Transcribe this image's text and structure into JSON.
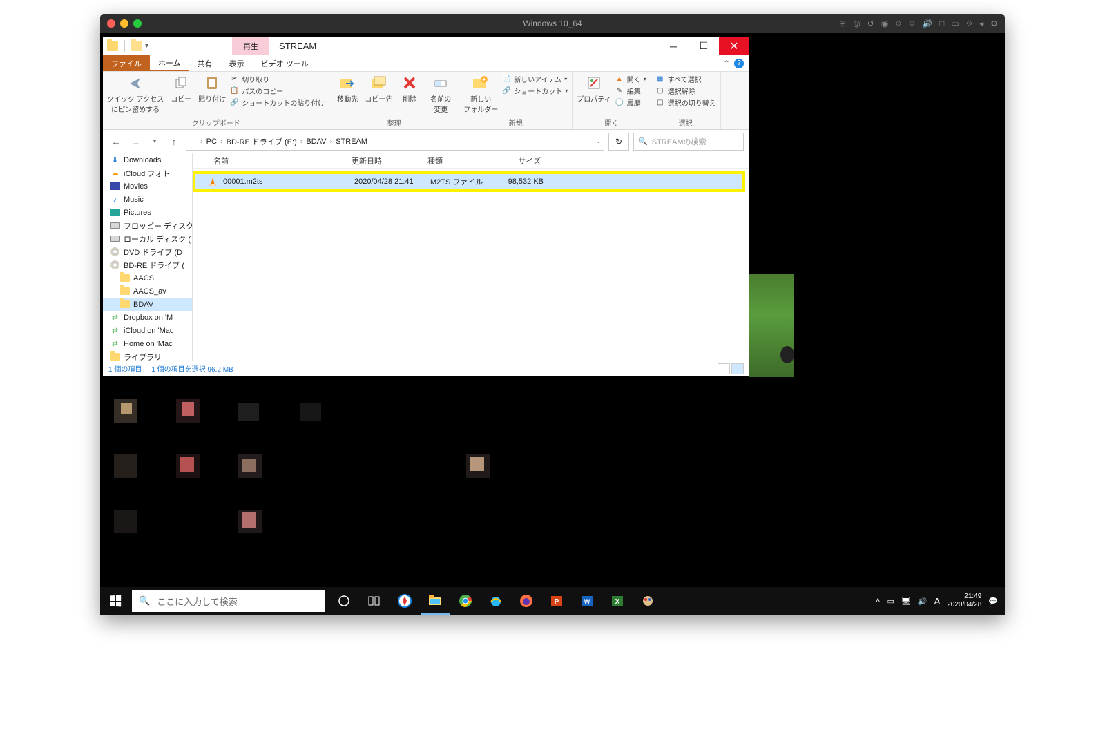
{
  "mac": {
    "title": "Windows 10_64",
    "menu_icons": [
      "⊞",
      "◎",
      "⟳",
      "⊙",
      "⟐",
      "⟐",
      "⟟",
      "⟐",
      "□",
      "⟐",
      "⟐",
      "❮",
      "⚙"
    ]
  },
  "explorer": {
    "playback_label": "再生",
    "window_title": "STREAM",
    "tabs": {
      "file": "ファイル",
      "home": "ホーム",
      "share": "共有",
      "view": "表示",
      "video": "ビデオ ツール"
    },
    "ribbon": {
      "clipboard": {
        "label": "クリップボード",
        "pin": "クイック アクセス\nにピン留めする",
        "copy": "コピー",
        "paste": "貼り付け",
        "cut": "切り取り",
        "copy_path": "パスのコピー",
        "paste_shortcut": "ショートカットの貼り付け"
      },
      "organize": {
        "label": "整理",
        "move": "移動先",
        "copyto": "コピー先",
        "delete": "削除",
        "rename": "名前の\n変更"
      },
      "new": {
        "label": "新規",
        "folder": "新しい\nフォルダー",
        "item": "新しいアイテム",
        "shortcut": "ショートカット"
      },
      "open": {
        "label": "開く",
        "props": "プロパティ",
        "open": "開く",
        "edit": "編集",
        "history": "履歴"
      },
      "select": {
        "label": "選択",
        "all": "すべて選択",
        "none": "選択解除",
        "invert": "選択の切り替え"
      }
    },
    "breadcrumb": [
      "PC",
      "BD-RE ドライブ (E:)",
      "BDAV",
      "STREAM"
    ],
    "search_placeholder": "STREAMの検索",
    "columns": {
      "name": "名前",
      "date": "更新日時",
      "type": "種類",
      "size": "サイズ"
    },
    "nav_items": [
      {
        "label": "Downloads",
        "icon": "down"
      },
      {
        "label": "iCloud フォト",
        "icon": "icloud"
      },
      {
        "label": "Movies",
        "icon": "movie"
      },
      {
        "label": "Music",
        "icon": "music"
      },
      {
        "label": "Pictures",
        "icon": "pic"
      },
      {
        "label": "フロッピー ディスク",
        "icon": "drive"
      },
      {
        "label": "ローカル ディスク (",
        "icon": "drive"
      },
      {
        "label": "DVD ドライブ (D",
        "icon": "disc"
      },
      {
        "label": "BD-RE ドライブ (",
        "icon": "disc"
      },
      {
        "label": "AACS",
        "icon": "folder",
        "indent": 1
      },
      {
        "label": "AACS_av",
        "icon": "folder",
        "indent": 1
      },
      {
        "label": "BDAV",
        "icon": "folder",
        "indent": 1,
        "selected": true
      },
      {
        "label": "Dropbox on 'M",
        "icon": "net"
      },
      {
        "label": "iCloud on 'Mac",
        "icon": "net"
      },
      {
        "label": "Home on 'Mac",
        "icon": "net"
      },
      {
        "label": "ライブラリ",
        "icon": "folder"
      }
    ],
    "file": {
      "name": "00001.m2ts",
      "date": "2020/04/28 21:41",
      "type": "M2TS ファイル",
      "size": "98,532 KB"
    },
    "status": {
      "count": "1 個の項目",
      "selection": "1 個の項目を選択 96.2 MB"
    }
  },
  "taskbar": {
    "search_placeholder": "ここに入力して検索",
    "clock_time": "21:49",
    "clock_date": "2020/04/28"
  }
}
